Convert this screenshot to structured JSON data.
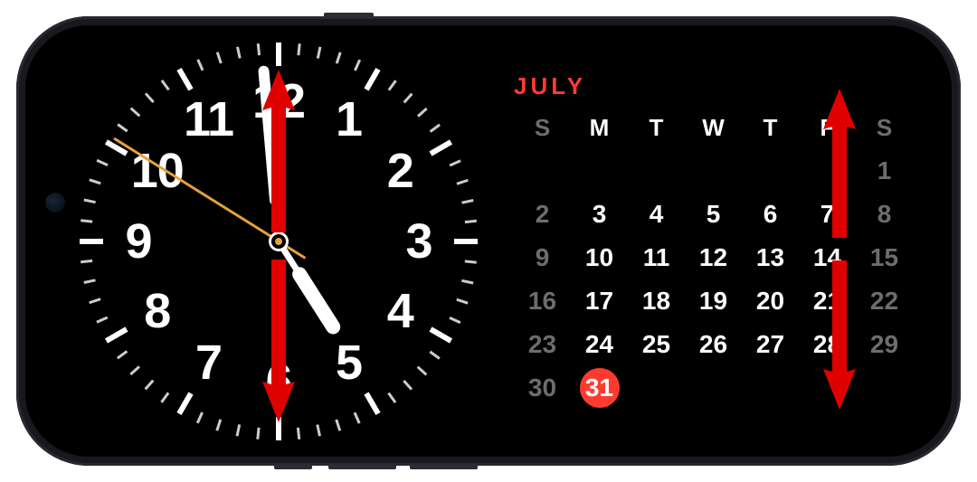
{
  "device": {
    "name": "iphone-landscape"
  },
  "clock": {
    "numerals": [
      "12",
      "1",
      "2",
      "3",
      "4",
      "5",
      "6",
      "7",
      "8",
      "9",
      "10",
      "11"
    ],
    "hour_angle": 147.5,
    "minute_angle": 355,
    "second_angle": 302,
    "accent_color": "#e5a13c"
  },
  "calendar": {
    "month_label": "JULY",
    "weekday_labels": [
      "S",
      "M",
      "T",
      "W",
      "T",
      "F",
      "S"
    ],
    "weeks": [
      [
        "",
        "",
        "",
        "",
        "",
        "",
        "1"
      ],
      [
        "2",
        "3",
        "4",
        "5",
        "6",
        "7",
        "8"
      ],
      [
        "9",
        "10",
        "11",
        "12",
        "13",
        "14",
        "15"
      ],
      [
        "16",
        "17",
        "18",
        "19",
        "20",
        "21",
        "22"
      ],
      [
        "23",
        "24",
        "25",
        "26",
        "27",
        "28",
        "29"
      ],
      [
        "30",
        "31",
        "",
        "",
        "",
        "",
        ""
      ]
    ],
    "today": "31",
    "accent_color": "#ff3b30"
  },
  "arrows": {
    "description": "vertical swipe indicators",
    "color": "#ff0000"
  }
}
